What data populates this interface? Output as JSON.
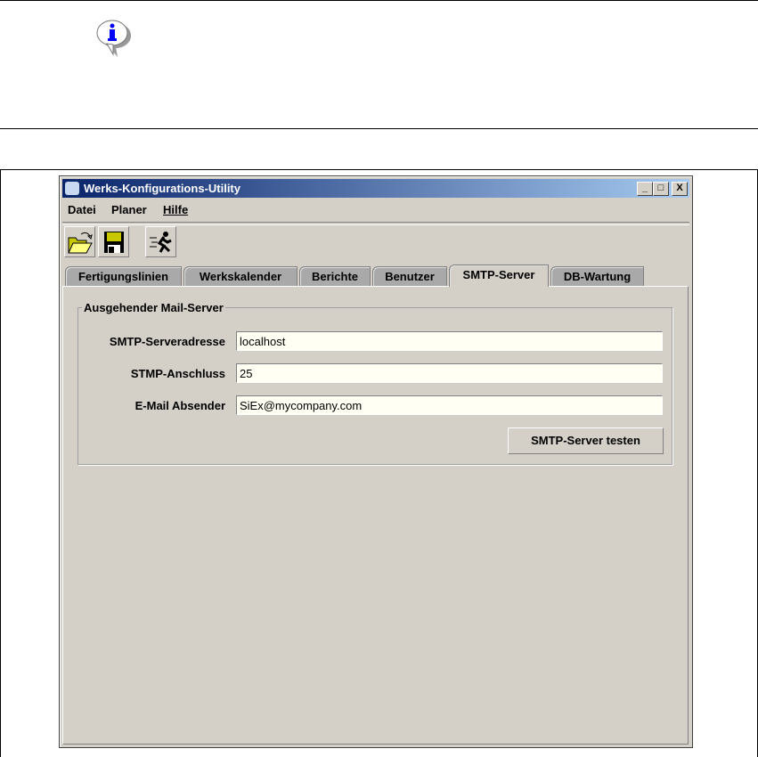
{
  "window": {
    "title": "Werks-Konfigurations-Utility",
    "minimize": "_",
    "maximize": "□",
    "close": "X"
  },
  "menu": [
    "Datei",
    "Planer",
    "Hilfe"
  ],
  "toolbar": [
    "open-folder-icon",
    "save-disk-icon",
    "run-icon"
  ],
  "tabs": [
    "Fertigungslinien",
    "Werkskalender",
    "Berichte",
    "Benutzer",
    "SMTP-Server",
    "DB-Wartung"
  ],
  "selected_tab": "SMTP-Server",
  "group": {
    "title": "Ausgehender Mail-Server",
    "fields": [
      {
        "label": "SMTP-Serveradresse",
        "value": "localhost"
      },
      {
        "label": "STMP-Anschluss",
        "value": "25"
      },
      {
        "label": "E-Mail Absender",
        "value": "SiEx@mycompany.com"
      }
    ],
    "test_button": "SMTP-Server testen"
  },
  "colors": {
    "title_start": "#0a246a",
    "title_end": "#a6caf0",
    "face": "#d4d0c8",
    "field_bg": "#fffff4"
  }
}
